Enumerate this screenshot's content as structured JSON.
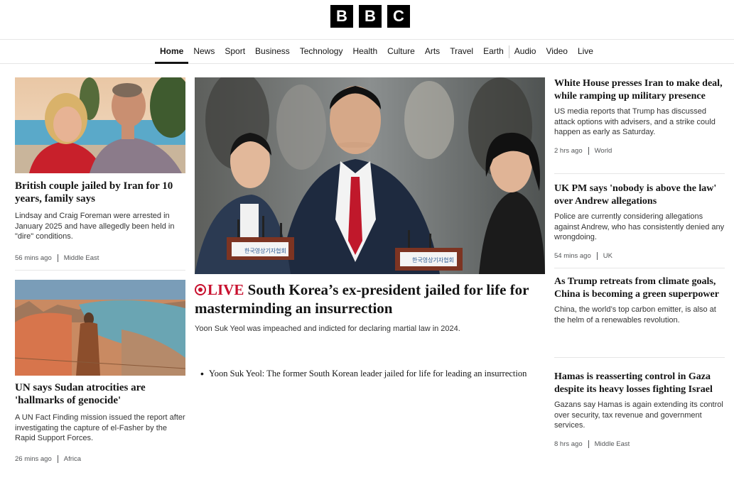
{
  "brand": {
    "letters": [
      "B",
      "B",
      "C"
    ]
  },
  "nav": {
    "items": [
      {
        "label": "Home",
        "active": true
      },
      {
        "label": "News"
      },
      {
        "label": "Sport"
      },
      {
        "label": "Business"
      },
      {
        "label": "Technology"
      },
      {
        "label": "Health"
      },
      {
        "label": "Culture"
      },
      {
        "label": "Arts"
      },
      {
        "label": "Travel"
      },
      {
        "label": "Earth"
      },
      {
        "label": "Audio"
      },
      {
        "label": "Video"
      },
      {
        "label": "Live"
      }
    ]
  },
  "left": [
    {
      "headline": "British couple jailed by Iran for 10 years, family says",
      "summary": "Lindsay and Craig Foreman were arrested in January 2025 and have allegedly been held in \"dire\" conditions.",
      "time": "56 mins ago",
      "section": "Middle East"
    },
    {
      "headline": "UN says Sudan atrocities are 'hallmarks of genocide'",
      "summary": "A UN Fact Finding mission issued the report after investigating the capture of el-Fasher by the Rapid Support Forces.",
      "time": "26 mins ago",
      "section": "Africa"
    }
  ],
  "lead": {
    "live_label": "LIVE",
    "headline": "South Korea’s ex-president jailed for life for masterminding an insurrection",
    "summary": "Yoon Suk Yeol was impeached and indicted for declaring martial law in 2024.",
    "related": "Yoon Suk Yeol: The former South Korean leader jailed for life for leading an insurrection",
    "podium_text": "한국영상기자협회"
  },
  "right": [
    {
      "headline": "White House presses Iran to make deal, while ramping up military presence",
      "summary": "US media reports that Trump has discussed attack options with advisers, and a strike could happen as early as Saturday.",
      "time": "2 hrs ago",
      "section": "World"
    },
    {
      "headline": "UK PM says 'nobody is above the law' over Andrew allegations",
      "summary": "Police are currently considering allegations against Andrew, who has consistently denied any wrongdoing.",
      "time": "54 mins ago",
      "section": "UK"
    },
    {
      "headline": "As Trump retreats from climate goals, China is becoming a green superpower",
      "summary": "China, the world’s top carbon emitter, is also at the helm of a renewables revolution."
    },
    {
      "headline": "Hamas is reasserting control in Gaza despite its heavy losses fighting Israel",
      "summary": "Gazans say Hamas is again extending its control over security, tax revenue and government services.",
      "time": "8 hrs ago",
      "section": "Middle East"
    }
  ],
  "colors": {
    "live": "#c8102e",
    "text": "#141414",
    "meta": "#545658"
  }
}
